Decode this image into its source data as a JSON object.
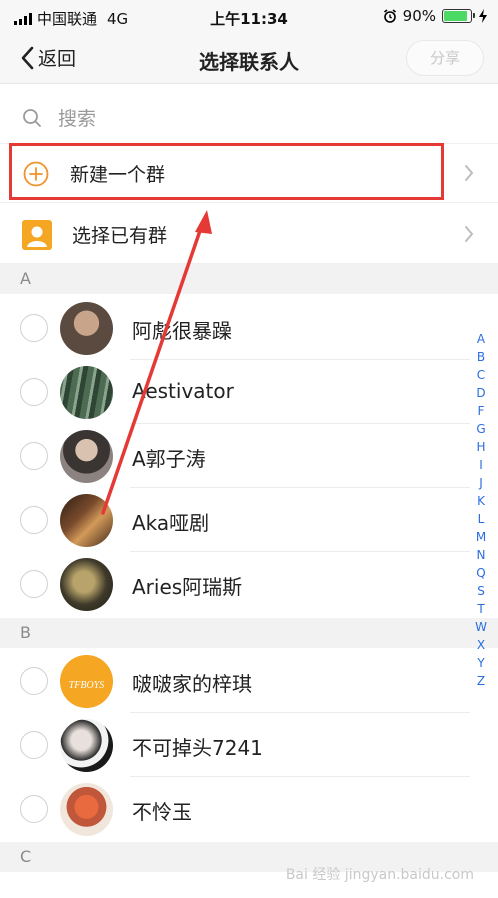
{
  "status_bar": {
    "carrier": "中国联通",
    "network": "4G",
    "time": "上午11:34",
    "battery": "90%",
    "battery_level": 0.9
  },
  "nav": {
    "back_label": "返回",
    "title": "选择联系人",
    "share_label": "分享"
  },
  "search": {
    "placeholder": "搜索"
  },
  "actions": [
    {
      "label": "新建一个群",
      "icon": "plus-circle-icon",
      "color": "#f0932b"
    },
    {
      "label": "选择已有群",
      "icon": "group-avatar-icon",
      "color": "#f5a623"
    }
  ],
  "sections": [
    {
      "letter": "A",
      "contacts": [
        {
          "name": "阿彪很暴躁",
          "avatar": "photo-avatar",
          "avatar_color": "#5b4a3f"
        },
        {
          "name": "Aestivator",
          "avatar": "photo-avatar",
          "avatar_color": "#4c6b52"
        },
        {
          "name": "A郭子涛",
          "avatar": "photo-avatar",
          "avatar_color": "#6a5e58"
        },
        {
          "name": "Aka哑剧",
          "avatar": "photo-avatar",
          "avatar_color": "#7a4b2c"
        },
        {
          "name": "Aries阿瑞斯",
          "avatar": "photo-avatar",
          "avatar_color": "#3f3a2a"
        }
      ]
    },
    {
      "letter": "B",
      "contacts": [
        {
          "name": "啵啵家的梓琪",
          "avatar": "logo-avatar",
          "avatar_color": "#f5a623",
          "avatar_text": "TFBOYS"
        },
        {
          "name": "不可掉头7241",
          "avatar": "photo-avatar",
          "avatar_color": "#2b2b2b"
        },
        {
          "name": "不怜玉",
          "avatar": "photo-avatar",
          "avatar_color": "#c0563a"
        }
      ]
    },
    {
      "letter": "C",
      "contacts": []
    }
  ],
  "index_letters": [
    "A",
    "B",
    "C",
    "D",
    "F",
    "G",
    "H",
    "I",
    "J",
    "K",
    "L",
    "M",
    "N",
    "Q",
    "S",
    "T",
    "W",
    "X",
    "Y",
    "Z"
  ],
  "watermark": "Bai 经验 jingyan.baidu.com",
  "colors": {
    "accent": "#f0932b",
    "highlight": "#e53935",
    "index": "#2b6de0"
  }
}
